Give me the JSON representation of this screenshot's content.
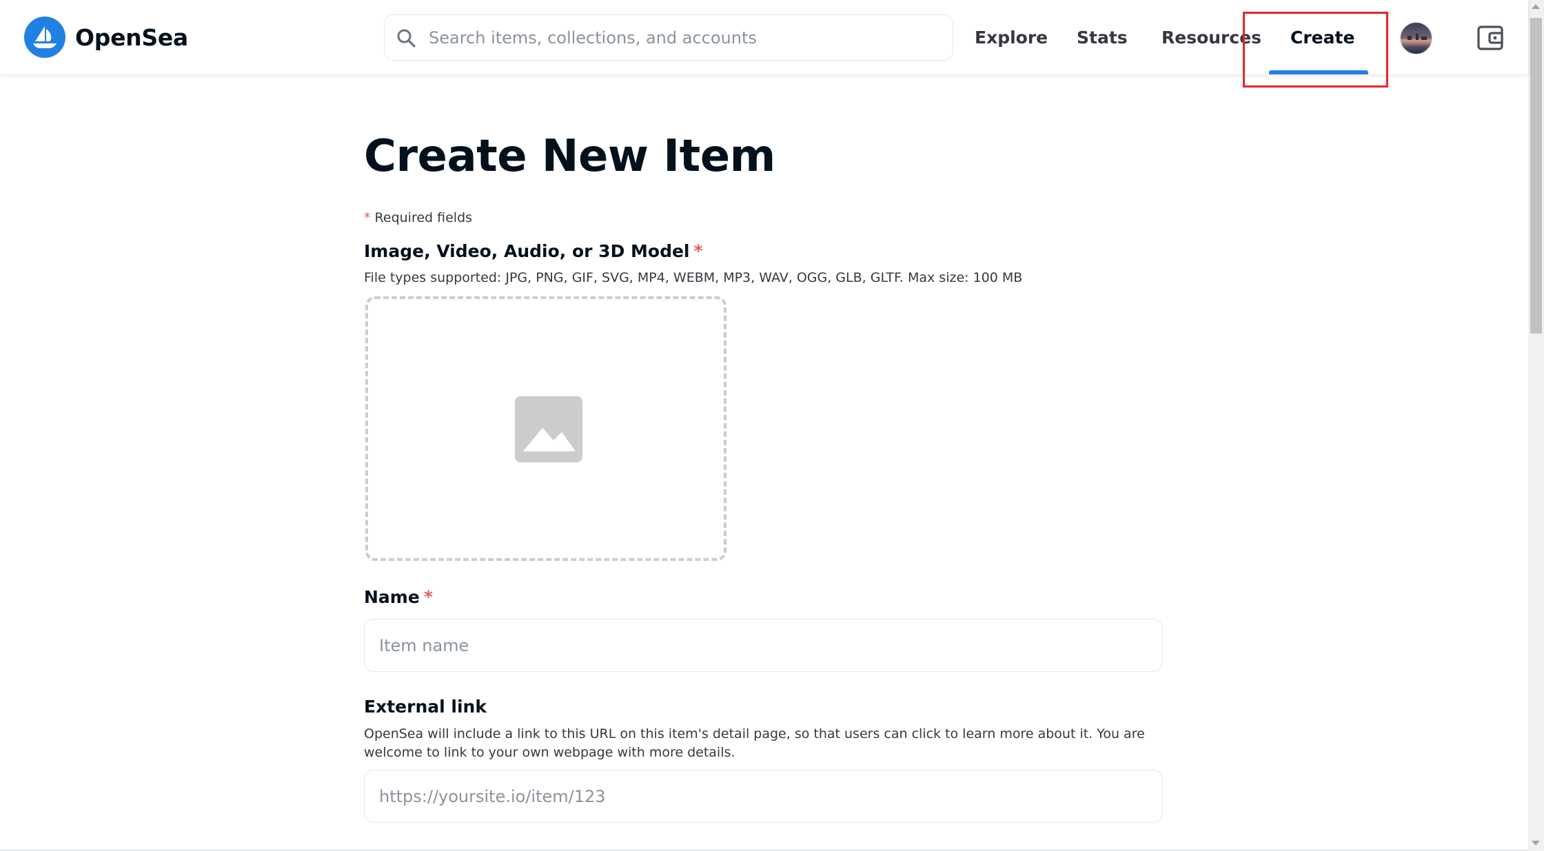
{
  "header": {
    "brand": "OpenSea",
    "search": {
      "placeholder": "Search items, collections, and accounts",
      "value": ""
    },
    "nav": {
      "explore": "Explore",
      "stats": "Stats",
      "resources": "Resources",
      "create": "Create"
    },
    "active_nav": "create"
  },
  "form": {
    "title": "Create New Item",
    "required_note_star": "*",
    "required_note": "Required fields",
    "media": {
      "label": "Image, Video, Audio, or 3D Model",
      "required_star": "*",
      "help": "File types supported: JPG, PNG, GIF, SVG, MP4, WEBM, MP3, WAV, OGG, GLB, GLTF. Max size: 100 MB"
    },
    "name": {
      "label": "Name",
      "required_star": "*",
      "placeholder": "Item name",
      "value": ""
    },
    "external_link": {
      "label": "External link",
      "help": "OpenSea will include a link to this URL on this item's detail page, so that users can click to learn more about it. You are welcome to link to your own webpage with more details.",
      "placeholder": "https://yoursite.io/item/123",
      "value": ""
    }
  },
  "colors": {
    "brand_blue": "#2081e2",
    "required_red": "#eb5757",
    "highlight_red": "#e3262a",
    "text_dark": "#04111d",
    "placeholder_gray": "#8a939b",
    "border_gray": "#e5e8eb"
  }
}
